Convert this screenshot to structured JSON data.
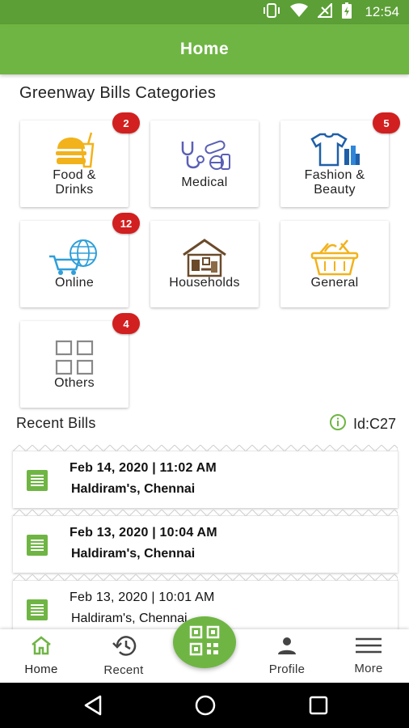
{
  "status_bar": {
    "time": "12:54"
  },
  "app_bar": {
    "title": "Home"
  },
  "categories": {
    "title": "Greenway Bills Categories",
    "items": [
      {
        "label": "Food &\nDrinks",
        "badge": "2",
        "icon": "burger-drink-icon"
      },
      {
        "label": "Medical",
        "badge": "",
        "icon": "stethoscope-pills-icon"
      },
      {
        "label": "Fashion &\nBeauty",
        "badge": "5",
        "icon": "tshirt-cosmetics-icon"
      },
      {
        "label": "Online",
        "badge": "12",
        "icon": "globe-cart-icon"
      },
      {
        "label": "Households",
        "badge": "",
        "icon": "house-furniture-icon"
      },
      {
        "label": "General",
        "badge": "",
        "icon": "basket-icon"
      },
      {
        "label": "Others",
        "badge": "4",
        "icon": "grid-icon"
      }
    ]
  },
  "recent": {
    "title": "Recent Bills",
    "user_id": "Id:C27",
    "bills": [
      {
        "date": "Feb 14, 2020 | 11:02 AM",
        "merchant": "Haldiram's, Chennai"
      },
      {
        "date": "Feb 13, 2020 | 10:04 AM",
        "merchant": "Haldiram's, Chennai"
      },
      {
        "date": "Feb 13, 2020 | 10:01 AM",
        "merchant": "Haldiram's, Chennai"
      }
    ]
  },
  "bottom_nav": {
    "home": "Home",
    "recent": "Recent",
    "profile": "Profile",
    "more": "More"
  },
  "colors": {
    "brand_green": "#6fb544",
    "status_green": "#5c9f36",
    "badge_red": "#d21f1f"
  }
}
